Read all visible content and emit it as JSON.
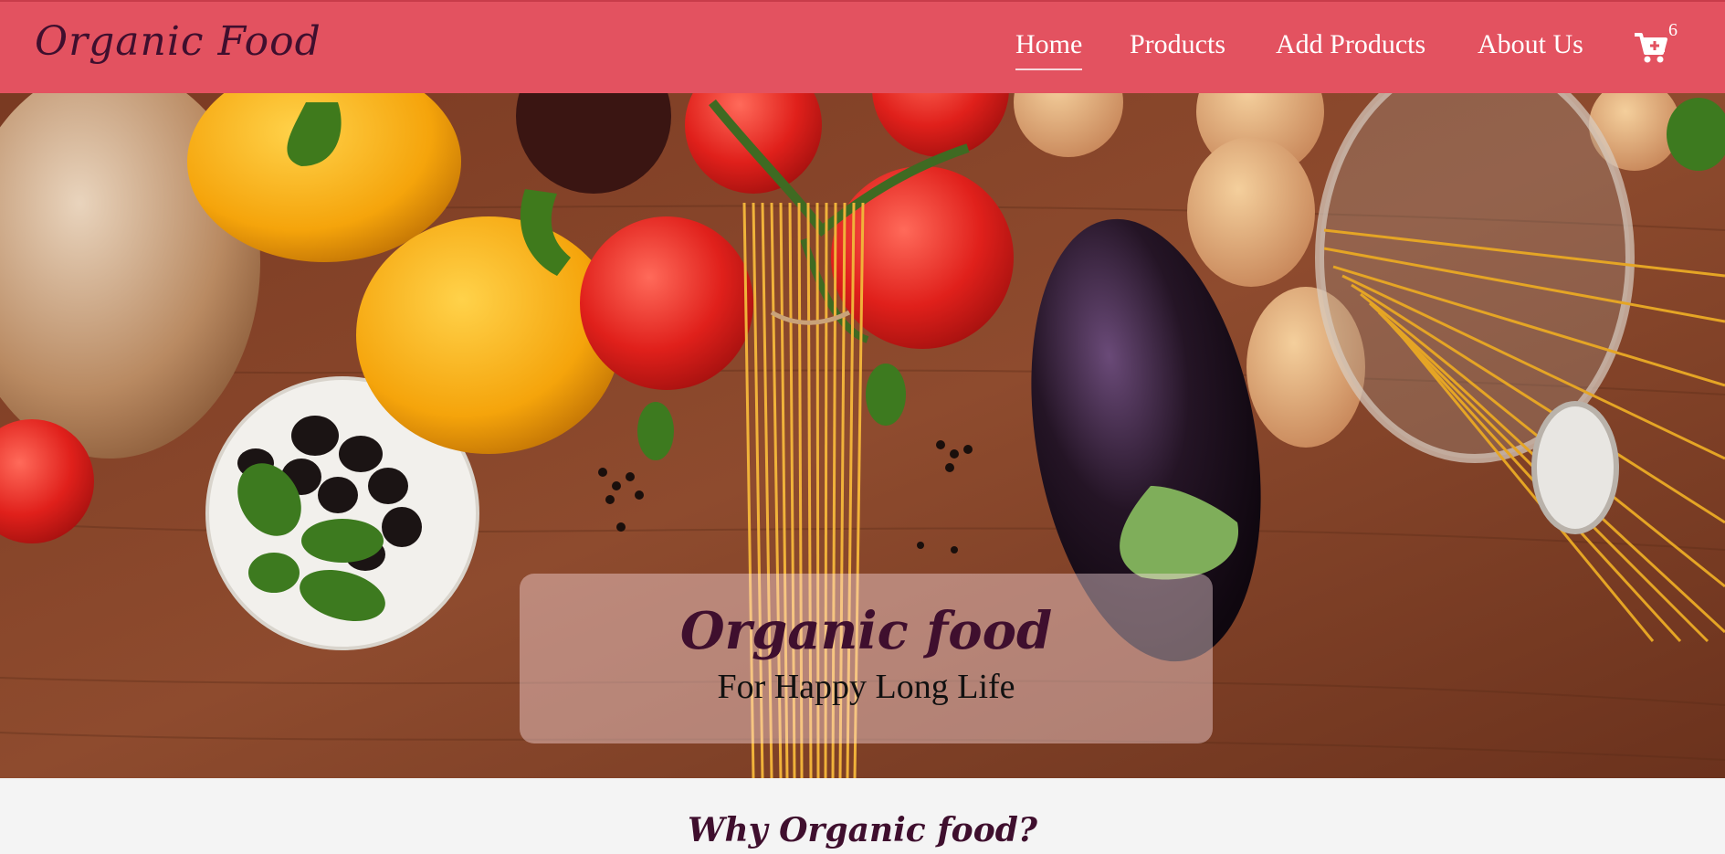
{
  "brand": {
    "name": "Organic Food"
  },
  "nav": {
    "items": [
      {
        "label": "Home",
        "active": true
      },
      {
        "label": "Products",
        "active": false
      },
      {
        "label": "Add Products",
        "active": false
      },
      {
        "label": "About Us",
        "active": false
      }
    ],
    "cart": {
      "icon": "cart-icon",
      "count": "6"
    }
  },
  "hero": {
    "title": "Organic food",
    "subtitle": "For Happy Long Life"
  },
  "section": {
    "heading": "Why Organic food?"
  },
  "colors": {
    "navbar": "#e35260",
    "brand_text": "#3f0f2e",
    "nav_text": "#ffffff",
    "page_background": "#f4f4f4"
  }
}
